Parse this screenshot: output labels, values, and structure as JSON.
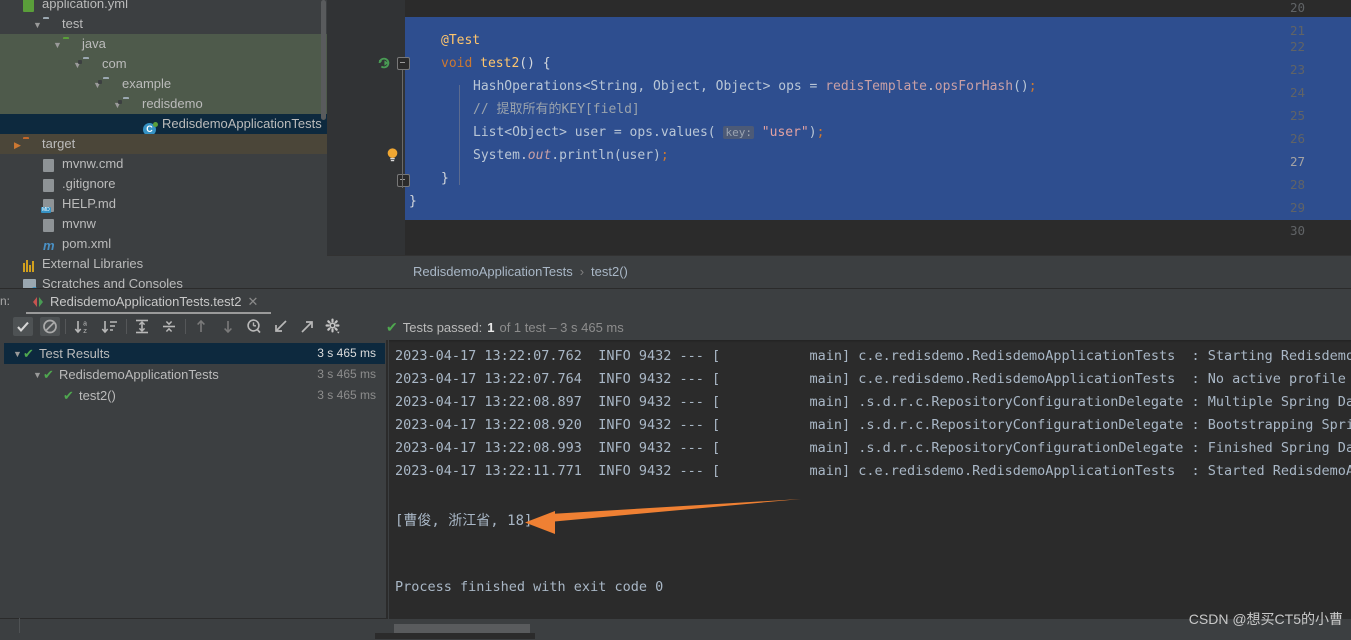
{
  "project_tree": {
    "items": [
      {
        "label": "application.yml",
        "indent": 0,
        "cut": true,
        "icon": "yml-file-icon",
        "twisty": ""
      },
      {
        "label": "test",
        "indent": 1,
        "icon": "folder-icon",
        "twisty": "▼"
      },
      {
        "label": "java",
        "indent": 2,
        "icon": "folder-green-icon",
        "twisty": "▼",
        "bg": "green"
      },
      {
        "label": "com",
        "indent": 3,
        "icon": "folder-package-icon",
        "twisty": "▼",
        "bg": "green"
      },
      {
        "label": "example",
        "indent": 4,
        "icon": "folder-package-icon",
        "twisty": "▼",
        "bg": "green"
      },
      {
        "label": "redisdemo",
        "indent": 5,
        "icon": "folder-package-icon",
        "twisty": "▼",
        "bg": "green"
      },
      {
        "label": "RedisdemoApplicationTests",
        "indent": 6,
        "icon": "test-class-icon",
        "twisty": "",
        "bg": "sel"
      },
      {
        "label": "target",
        "indent": 0,
        "icon": "folder-orange-icon",
        "twisty": "▶",
        "bg": "target"
      },
      {
        "label": "mvnw.cmd",
        "indent": 1,
        "icon": "script-file-icon",
        "twisty": ""
      },
      {
        "label": ".gitignore",
        "indent": 1,
        "icon": "gitignore-file-icon",
        "twisty": ""
      },
      {
        "label": "HELP.md",
        "indent": 1,
        "icon": "markdown-file-icon",
        "twisty": ""
      },
      {
        "label": "mvnw",
        "indent": 1,
        "icon": "shell-file-icon",
        "twisty": ""
      },
      {
        "label": "pom.xml",
        "indent": 1,
        "icon": "maven-file-icon",
        "twisty": ""
      },
      {
        "label": "External Libraries",
        "indent": 0,
        "icon": "libraries-icon",
        "twisty": ""
      },
      {
        "label": "Scratches and Consoles",
        "indent": 0,
        "icon": "scratches-icon",
        "twisty": ""
      }
    ]
  },
  "editor": {
    "line_numbers": [
      "20",
      "21",
      "22",
      "23",
      "24",
      "25",
      "26",
      "27",
      "28",
      "29",
      "30"
    ],
    "current_line": "27",
    "code_lines": [
      {
        "n": "22",
        "text": "    @Test"
      },
      {
        "n": "23",
        "text": "    void test2() {"
      },
      {
        "n": "24",
        "text": "        HashOperations<String, Object, Object> ops = redisTemplate.opsForHash();"
      },
      {
        "n": "25",
        "text": "        // 提取所有的KEY[field]"
      },
      {
        "n": "26",
        "text": "        List<Object> user = ops.values( key: \"user\");"
      },
      {
        "n": "27",
        "text": "        System.out.println(user);"
      },
      {
        "n": "28",
        "text": "    }"
      },
      {
        "n": "29",
        "text": "}"
      }
    ],
    "annotation": "@Test",
    "method_signature": "void test2() {",
    "hash_ops_type": "HashOperations<String, Object, Object>",
    "hash_ops_var": "ops",
    "hash_ops_call": "redisTemplate.opsForHash();",
    "comment": "// 提取所有的KEY[field]",
    "list_decl": "List<Object> user = ops.values(",
    "param_hint": "key:",
    "param_value": "\"user\"",
    "list_tail": ");",
    "println_line": "System.out.println(user);",
    "close_brace_inner": "}",
    "close_brace_outer": "}"
  },
  "breadcrumb": {
    "class": "RedisdemoApplicationTests",
    "separator": "›",
    "method": "test2()"
  },
  "run_panel": {
    "label": "n:",
    "tab_title": "RedisdemoApplicationTests.test2",
    "close": "✕"
  },
  "toolbar": {
    "icons": [
      {
        "name": "show-passed-toggle",
        "glyph": "✔",
        "active": true
      },
      {
        "name": "show-ignored-toggle",
        "glyph": "⊘",
        "active": true
      },
      {
        "name": "sort-alphabetically-icon",
        "glyph": "↓a/z"
      },
      {
        "name": "sort-by-duration-icon",
        "glyph": "↓≡"
      },
      {
        "name": "expand-all-icon",
        "glyph": "⤓"
      },
      {
        "name": "collapse-all-icon",
        "glyph": "⤒"
      },
      {
        "name": "previous-failed-icon",
        "glyph": "↑"
      },
      {
        "name": "next-failed-icon",
        "glyph": "↓"
      },
      {
        "name": "test-history-icon",
        "glyph": "🕐"
      },
      {
        "name": "import-tests-icon",
        "glyph": "↙"
      },
      {
        "name": "export-tests-icon",
        "glyph": "↗"
      },
      {
        "name": "settings-gear-icon",
        "glyph": "⚙"
      }
    ]
  },
  "tests_status": {
    "check": "✔",
    "label": "Tests passed:",
    "count": "1",
    "rest": "of 1 test – 3 s 465 ms"
  },
  "test_tree": {
    "rows": [
      {
        "label": "Test Results",
        "duration": "3 s 465 ms",
        "indent": 0,
        "twisty": "▼",
        "selected": true
      },
      {
        "label": "RedisdemoApplicationTests",
        "duration": "3 s 465 ms",
        "indent": 1,
        "twisty": "▼",
        "selected": false
      },
      {
        "label": "test2()",
        "duration": "3 s 465 ms",
        "indent": 2,
        "twisty": "",
        "selected": false
      }
    ]
  },
  "console": {
    "log_lines": [
      "2023-04-17 13:22:07.762  INFO 9432 --- [           main] c.e.redisdemo.RedisdemoApplicationTests  : Starting RedisdemoAp",
      "2023-04-17 13:22:07.764  INFO 9432 --- [           main] c.e.redisdemo.RedisdemoApplicationTests  : No active profile se",
      "2023-04-17 13:22:08.897  INFO 9432 --- [           main] .s.d.r.c.RepositoryConfigurationDelegate : Multiple Spring Data",
      "2023-04-17 13:22:08.920  INFO 9432 --- [           main] .s.d.r.c.RepositoryConfigurationDelegate : Bootstrapping Spring",
      "2023-04-17 13:22:08.993  INFO 9432 --- [           main] .s.d.r.c.RepositoryConfigurationDelegate : Finished Spring Data",
      "2023-04-17 13:22:11.771  INFO 9432 --- [           main] c.e.redisdemo.RedisdemoApplicationTests  : Started RedisdemoApp"
    ],
    "result_line": "[曹俊, 浙江省, 18]",
    "process_line": "Process finished with exit code 0"
  },
  "annotation": {
    "arrow_color": "#ef8033"
  },
  "watermark": {
    "text": "CSDN @想买CT5的小曹"
  },
  "colors": {
    "bg_panel": "#3c3f41",
    "bg_editor": "#2b2b2b",
    "selection_blue": "#2e4e8f",
    "tree_selection": "#0d293e",
    "green_check": "#4fa84f",
    "accent_orange": "#ef8033"
  }
}
